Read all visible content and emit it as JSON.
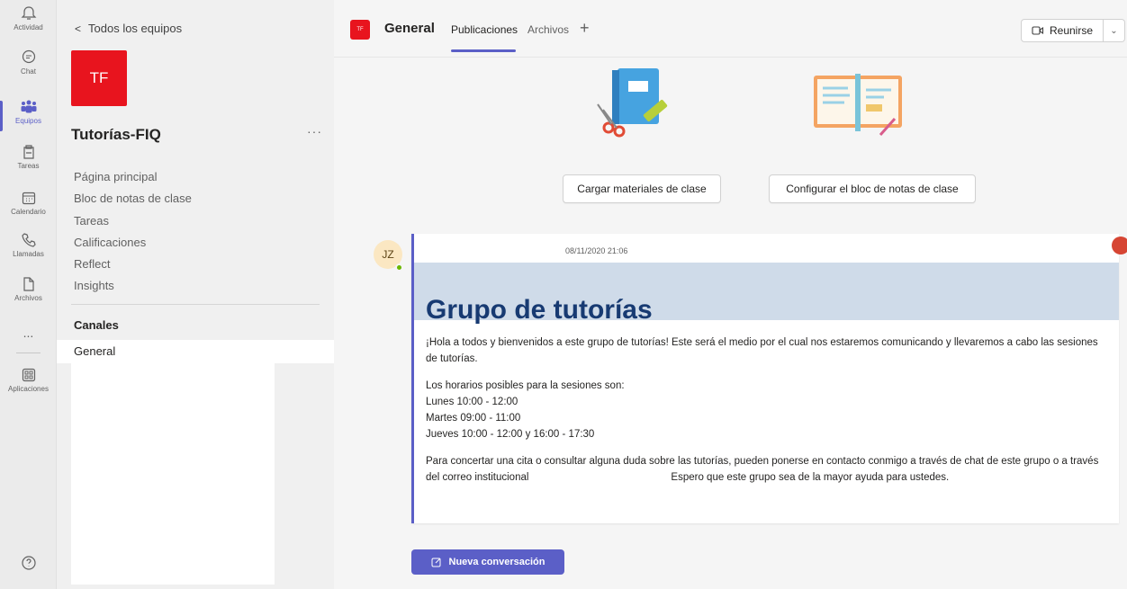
{
  "app_bar": {
    "items": [
      {
        "label": "Actividad",
        "icon": "bell-icon"
      },
      {
        "label": "Chat",
        "icon": "chat-icon"
      },
      {
        "label": "Equipos",
        "icon": "teams-icon",
        "active": true
      },
      {
        "label": "Tareas",
        "icon": "assignments-icon"
      },
      {
        "label": "Calendario",
        "icon": "calendar-icon"
      },
      {
        "label": "Llamadas",
        "icon": "phone-icon"
      },
      {
        "label": "Archivos",
        "icon": "file-icon"
      },
      {
        "label": "Aplicaciones",
        "icon": "apps-icon"
      }
    ],
    "more": "...",
    "help_icon": "help-icon"
  },
  "sidebar": {
    "back_label": "Todos los equipos",
    "team_initials": "TF",
    "team_name": "Tutorías-FIQ",
    "more": "···",
    "nav": [
      "Página principal",
      "Bloc de notas de clase",
      "Tareas",
      "Calificaciones",
      "Reflect",
      "Insights"
    ],
    "channels_heading": "Canales",
    "channels": [
      "General"
    ]
  },
  "header": {
    "channel_initials": "TF",
    "channel_name": "General",
    "tabs": [
      "Publicaciones",
      "Archivos"
    ],
    "add_tab": "+",
    "meet_label": "Reunirse",
    "meet_dropdown": "⌄"
  },
  "actions": {
    "upload_label": "Cargar materiales de clase",
    "notebook_label": "Configurar el bloc de notas de clase"
  },
  "post": {
    "author_initials": "JZ",
    "timestamp": "08/11/2020 21:06",
    "title": "Grupo de tutorías",
    "intro": "¡Hola a todos y bienvenidos a este grupo de tutorías! Este será el medio por el cual nos estaremos comunicando y llevaremos a cabo las sesiones de tutorías.",
    "schedule_heading": "Los horarios posibles para la sesiones son:",
    "schedule": [
      "Lunes 10:00 - 12:00",
      "Martes 09:00 - 11:00",
      "Jueves 10:00 - 12:00 y 16:00 - 17:30"
    ],
    "contact": "Para concertar una cita o consultar alguna duda sobre las tutorías, pueden ponerse en contacto conmigo a través de chat de este grupo o a través del correo institucional",
    "closing": "Espero que este grupo sea de la mayor ayuda para ustedes."
  },
  "new_conversation_label": "Nueva conversación",
  "colors": {
    "accent": "#5b5fc7",
    "team": "#e8141e",
    "banner": "#cfdbe9",
    "banner_title": "#173a72"
  }
}
